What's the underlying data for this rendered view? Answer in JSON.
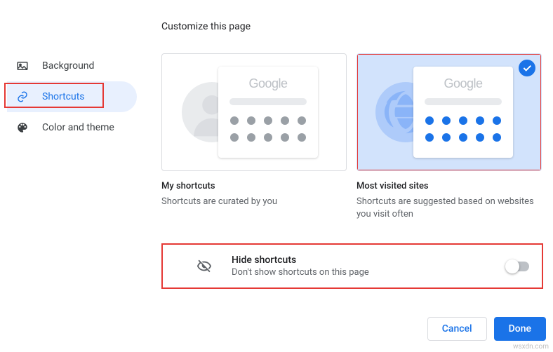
{
  "page_title": "Customize this page",
  "sidebar": {
    "items": [
      {
        "label": "Background",
        "active": false
      },
      {
        "label": "Shortcuts",
        "active": true
      },
      {
        "label": "Color and theme",
        "active": false
      }
    ]
  },
  "options": {
    "my_shortcuts": {
      "title": "My shortcuts",
      "desc": "Shortcuts are curated by you",
      "logo": "Google",
      "selected": false
    },
    "most_visited": {
      "title": "Most visited sites",
      "desc": "Shortcuts are suggested based on websites you visit often",
      "logo": "Google",
      "selected": true
    }
  },
  "hide": {
    "title": "Hide shortcuts",
    "desc": "Don't show shortcuts on this page",
    "enabled": false
  },
  "footer": {
    "cancel": "Cancel",
    "done": "Done"
  },
  "watermark": "wsxdn.com"
}
